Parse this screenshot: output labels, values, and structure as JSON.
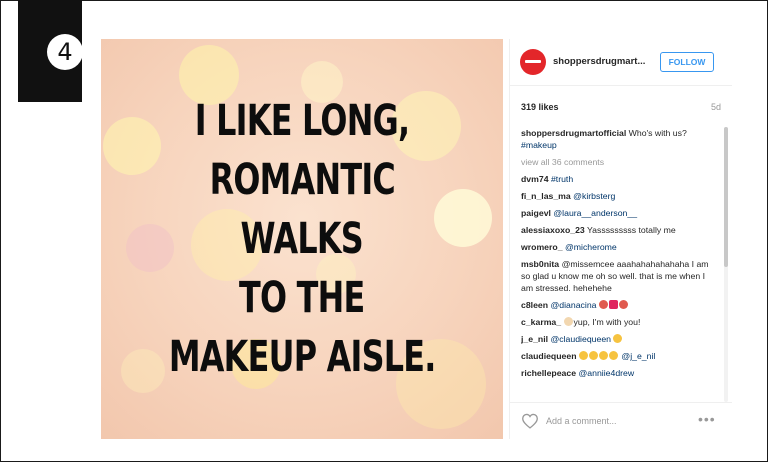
{
  "badge": {
    "number": "4"
  },
  "post": {
    "headline_lines": [
      "I LIKE LONG,",
      "ROMANTIC",
      "WALKS",
      "TO THE",
      "MAKEUP AISLE."
    ]
  },
  "header": {
    "username": "shoppersdrugmart...",
    "follow_label": "FOLLOW"
  },
  "stats": {
    "likes": "319 likes",
    "age": "5d"
  },
  "caption": {
    "username": "shoppersdrugmartofficial",
    "text": "Who's with us?",
    "hashtag": "#makeup"
  },
  "view_all": "view all 36 comments",
  "comments": [
    {
      "username": "dvm74",
      "text": "#truth"
    },
    {
      "username": "fi_n_las_ma",
      "text": "@kirbsterg"
    },
    {
      "username": "paigevl",
      "text": "@laura__anderson__"
    },
    {
      "username": "alessiaxoxo_23",
      "text": "Yasssssssss totally me"
    },
    {
      "username": "wromero_",
      "text": "@micherome"
    },
    {
      "username": "msb0nita",
      "text": "@missemcee aaahahahahahaha I am so glad u know me oh so well. that is me when I am stressed. hehehehe"
    },
    {
      "username": "c8leen",
      "text": "@dianacina"
    },
    {
      "username": "c_karma_",
      "text": "yup, I'm with you!"
    },
    {
      "username": "j_e_nil",
      "text": "@claudiequeen"
    },
    {
      "username": "claudiequeen",
      "text": "@j_e_nil"
    },
    {
      "username": "richellepeace",
      "text": "@anniie4drew"
    }
  ],
  "footer": {
    "placeholder": "Add a comment...",
    "more": "•••"
  },
  "colors": {
    "follow": "#3897f0",
    "brand": "#e3262a"
  }
}
